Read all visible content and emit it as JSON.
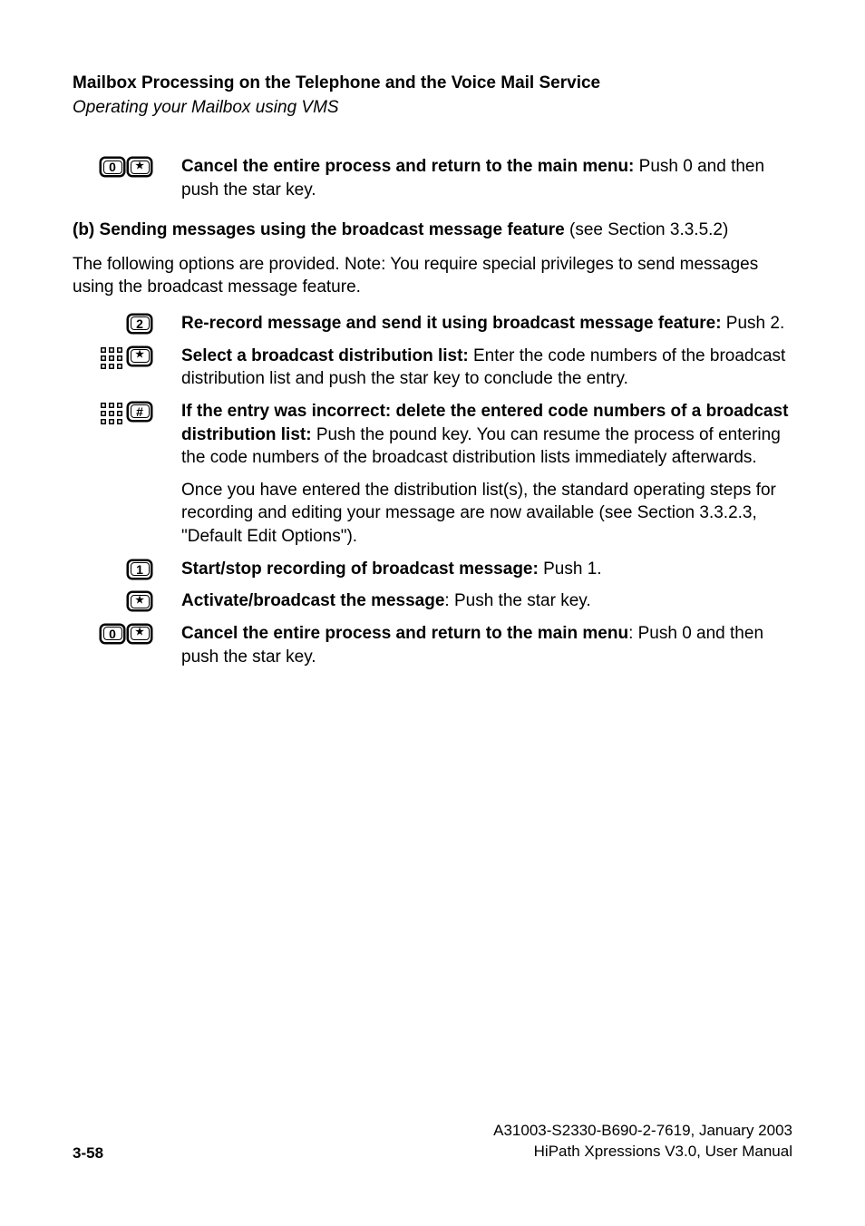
{
  "header": {
    "title": "Mailbox Processing on the Telephone and the Voice Mail Service",
    "subtitle": "Operating your Mailbox using VMS"
  },
  "rows": [
    {
      "icon1": {
        "type": "key",
        "label": "0"
      },
      "icon2": {
        "type": "key",
        "label": "*"
      },
      "bold": "Cancel the entire process and return to the main menu:",
      "rest": " Push 0 and then push the star key."
    }
  ],
  "subheading": {
    "bold": "(b) Sending messages using the broadcast message feature",
    "rest": " (see Section 3.3.5.2)"
  },
  "intro": "The following options are provided. Note: You require special privileges to send messages using the broadcast message feature.",
  "rows2": [
    {
      "icon1": null,
      "icon2": {
        "type": "key",
        "label": "2"
      },
      "bold": "Re-record message and send it using broadcast message feature:",
      "rest": " Push 2."
    },
    {
      "icon1": {
        "type": "keypad"
      },
      "icon2": {
        "type": "key",
        "label": "*"
      },
      "bold": "Select a broadcast distribution list:",
      "rest": " Enter the code numbers of the broadcast distribution list and push the star key to conclude the entry."
    },
    {
      "icon1": {
        "type": "keypad"
      },
      "icon2": {
        "type": "key",
        "label": "#"
      },
      "bold": "If the entry was incorrect: delete the entered code numbers of a broadcast distribution list:",
      "rest": " Push the pound key. You can resume the process of entering the code numbers of the broadcast distribution lists immediately afterwards."
    }
  ],
  "extra_para": "Once you have entered the distribution list(s), the standard operating steps for recording and editing your message are now available (see Section 3.3.2.3, \"Default Edit Options\").",
  "rows3": [
    {
      "icon1": null,
      "icon2": {
        "type": "key",
        "label": "1"
      },
      "bold": "Start/stop recording of broadcast message:",
      "rest": " Push 1."
    },
    {
      "icon1": null,
      "icon2": {
        "type": "key",
        "label": "*"
      },
      "bold": "Activate/broadcast the message",
      "rest": ": Push the star key."
    },
    {
      "icon1": {
        "type": "key",
        "label": "0"
      },
      "icon2": {
        "type": "key",
        "label": "*"
      },
      "bold": "Cancel the entire process and return to the main menu",
      "rest": ": Push 0 and then push the star key."
    }
  ],
  "footer": {
    "page": "3-58",
    "docid": "A31003-S2330-B690-2-7619, January 2003",
    "docname": "HiPath Xpressions V3.0, User Manual"
  }
}
